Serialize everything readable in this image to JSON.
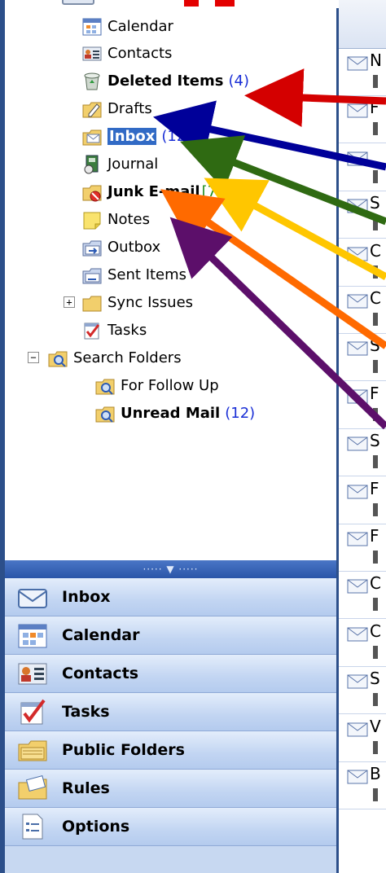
{
  "folders": {
    "calendar": "Calendar",
    "contacts": "Contacts",
    "deleted_items": "Deleted Items",
    "deleted_items_count": "(4)",
    "drafts": "Drafts",
    "inbox": "Inbox",
    "inbox_count": "(12)",
    "journal": "Journal",
    "junk_email": "Junk E-mail",
    "junk_email_count": "[7]",
    "notes": "Notes",
    "outbox": "Outbox",
    "sent_items": "Sent Items",
    "sync_issues": "Sync Issues",
    "tasks": "Tasks",
    "search_folders": "Search Folders",
    "for_follow_up": "For Follow Up",
    "unread_mail": "Unread Mail",
    "unread_mail_count": "(12)"
  },
  "nav": {
    "splitter": "····· ▼ ·····",
    "inbox": "Inbox",
    "calendar": "Calendar",
    "contacts": "Contacts",
    "tasks": "Tasks",
    "public_folders": "Public Folders",
    "rules": "Rules",
    "options": "Options"
  },
  "messages": {
    "initials": [
      "N",
      "F",
      "",
      "S",
      "C",
      "C",
      "S",
      "F",
      "S",
      "F",
      "F",
      "C",
      "C",
      "S",
      "V",
      "B"
    ]
  },
  "annotation_colors": {
    "deleted_items": "#d40000",
    "inbox": "#000099",
    "journal": "#2f6a12",
    "junk_email": "#ffc600",
    "notes": "#ff6a00",
    "outbox": "#5c0f6a"
  }
}
